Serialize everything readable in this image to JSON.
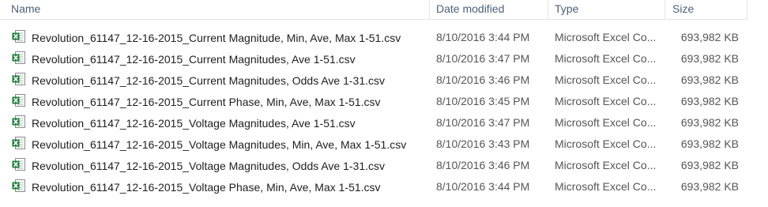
{
  "columns": {
    "name": "Name",
    "date": "Date modified",
    "type": "Type",
    "size": "Size"
  },
  "files": [
    {
      "name": "Revolution_61147_12-16-2015_Current Magnitude, Min, Ave, Max 1-51.csv",
      "date": "8/10/2016 3:44 PM",
      "type": "Microsoft Excel Co...",
      "size": "693,982 KB"
    },
    {
      "name": "Revolution_61147_12-16-2015_Current Magnitudes, Ave 1-51.csv",
      "date": "8/10/2016 3:47 PM",
      "type": "Microsoft Excel Co...",
      "size": "693,982 KB"
    },
    {
      "name": "Revolution_61147_12-16-2015_Current Magnitudes, Odds Ave 1-31.csv",
      "date": "8/10/2016 3:46 PM",
      "type": "Microsoft Excel Co...",
      "size": "693,982 KB"
    },
    {
      "name": "Revolution_61147_12-16-2015_Current Phase, Min, Ave, Max 1-51.csv",
      "date": "8/10/2016 3:45 PM",
      "type": "Microsoft Excel Co...",
      "size": "693,982 KB"
    },
    {
      "name": "Revolution_61147_12-16-2015_Voltage Magnitudes, Ave 1-51.csv",
      "date": "8/10/2016 3:47 PM",
      "type": "Microsoft Excel Co...",
      "size": "693,982 KB"
    },
    {
      "name": "Revolution_61147_12-16-2015_Voltage Magnitudes, Min, Ave, Max 1-51.csv",
      "date": "8/10/2016 3:43 PM",
      "type": "Microsoft Excel Co...",
      "size": "693,982 KB"
    },
    {
      "name": "Revolution_61147_12-16-2015_Voltage Magnitudes, Odds Ave 1-31.csv",
      "date": "8/10/2016 3:46 PM",
      "type": "Microsoft Excel Co...",
      "size": "693,982 KB"
    },
    {
      "name": "Revolution_61147_12-16-2015_Voltage Phase, Min, Ave, Max 1-51.csv",
      "date": "8/10/2016 3:44 PM",
      "type": "Microsoft Excel Co...",
      "size": "693,982 KB"
    }
  ],
  "icons": {
    "file": "excel-csv-file-icon"
  },
  "colors": {
    "header_text": "#4c607a",
    "excel_green": "#1f7a3a"
  }
}
